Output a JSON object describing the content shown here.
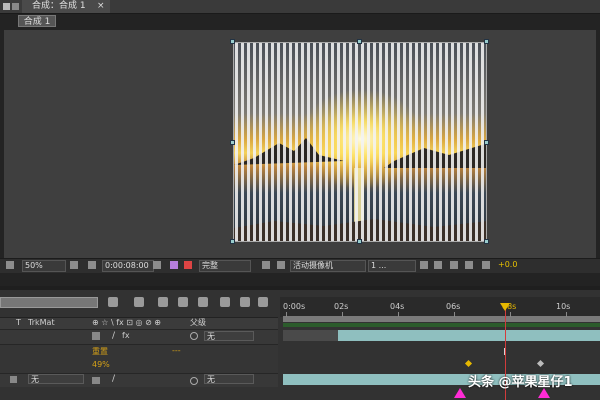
{
  "window": {
    "comp_tab_label": "合成：合成 1",
    "close_glyph": "×",
    "subtab_label": "合成 1"
  },
  "viewer_controls": {
    "zoom": "50%",
    "timecode": "0:00:08:00",
    "resolution": "完整",
    "camera": "活动摄像机",
    "views": "1 ...",
    "exposure": "+0.0"
  },
  "timeline": {
    "columns": {
      "t": "T",
      "trkmat": "TrkMat",
      "switches": "⊕ ☆ \\ fx ⊡ ◎ ⊘ ⊕",
      "parent": "父级"
    },
    "layer1": {
      "parent_value": "无"
    },
    "property": {
      "name": "重置",
      "dashes": "---",
      "value": "49%"
    },
    "layer2": {
      "trkmat_value": "无",
      "parent_value": "无"
    },
    "ruler": [
      "0:00s",
      "02s",
      "04s",
      "06s",
      "08s",
      "10s"
    ]
  },
  "colors": {
    "accent_yellow": "#e6b800",
    "cti_red": "#d23c3c",
    "layer_teal": "#8fbfbf",
    "arrow_magenta": "#ff2bd6"
  },
  "watermark": "头条 @苹果星仔1"
}
